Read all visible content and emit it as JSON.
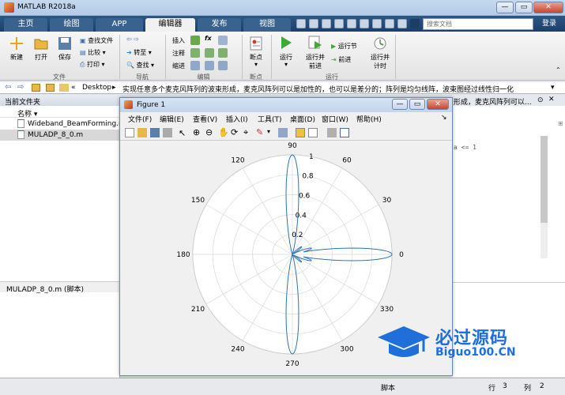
{
  "window": {
    "title": "MATLAB R2018a"
  },
  "tabs": [
    "主页",
    "绘图",
    "APP",
    "编辑器",
    "发布",
    "视图"
  ],
  "search": {
    "placeholder": "搜索文档"
  },
  "login_label": "登录",
  "toolstrip": {
    "file": {
      "new": "新建",
      "open": "打开",
      "save": "保存",
      "find_files": "查找文件",
      "compare": "比较",
      "print": "打印",
      "group": "文件"
    },
    "nav": {
      "goto": "转至",
      "find": "查找",
      "group": "导航"
    },
    "edit": {
      "insert": "插入",
      "comment": "注释",
      "indent": "缩进",
      "fx": "fx",
      "group": "编辑"
    },
    "breakpoints": {
      "label": "断点",
      "group": "断点"
    },
    "run": {
      "run": "运行",
      "run_advance": "运行并\n前进",
      "run_section": "运行节",
      "advance": "前进",
      "run_time": "运行并\n计时",
      "group": "运行"
    }
  },
  "address": {
    "path": "Desktop",
    "breadcrumb_prefix": "«",
    "message": "实现任意多个麦克风阵列的波束形成，麦克风阵列可以是加性的，也可以是差分的；阵列是均匀线阵，波束图经过线性归一化"
  },
  "current_folder": {
    "header": "当前文件夹",
    "col_name": "名称 ▾",
    "files": [
      "Wideband_BeamForming.m",
      "MULADP_8_0.m"
    ],
    "details": "MULADP_8_0.m  (脚本)"
  },
  "editor_peek": {
    "line1": "形成，麦克风阵列可以...",
    "code_frag": "a <= 1"
  },
  "status": {
    "script": "脚本",
    "row_label": "行",
    "row_value": "3",
    "col_label": "列",
    "col_value": "2"
  },
  "figure": {
    "title": "Figure 1",
    "menu": [
      "文件(F)",
      "编辑(E)",
      "查看(V)",
      "插入(I)",
      "工具(T)",
      "桌面(D)",
      "窗口(W)",
      "帮助(H)"
    ]
  },
  "chart_data": {
    "type": "polar",
    "angle_labels": [
      "0",
      "30",
      "60",
      "90",
      "120",
      "150",
      "180",
      "210",
      "240",
      "270",
      "300",
      "330"
    ],
    "radial_labels": [
      "0.2",
      "0.4",
      "0.6",
      "0.8",
      "1"
    ],
    "rlim": [
      0,
      1
    ],
    "grid": true,
    "series": [
      {
        "description": "beam pattern",
        "color": "#2e74b5",
        "lobes": [
          {
            "theta_deg": 0,
            "r": 1.0
          },
          {
            "theta_deg": 90,
            "r": 1.0
          },
          {
            "theta_deg": 270,
            "r": 1.0
          },
          {
            "theta_deg": 18,
            "r": 0.2
          },
          {
            "theta_deg": 342,
            "r": 0.2
          },
          {
            "theta_deg": 40,
            "r": 0.12
          },
          {
            "theta_deg": 320,
            "r": 0.12
          }
        ]
      }
    ]
  },
  "watermark": {
    "line1": "必过源码",
    "line2": "Biguo100.CN",
    "color": "#1e6fd9"
  },
  "colors": {
    "accent": "#2d5685",
    "plot_line": "#2e74b5"
  }
}
